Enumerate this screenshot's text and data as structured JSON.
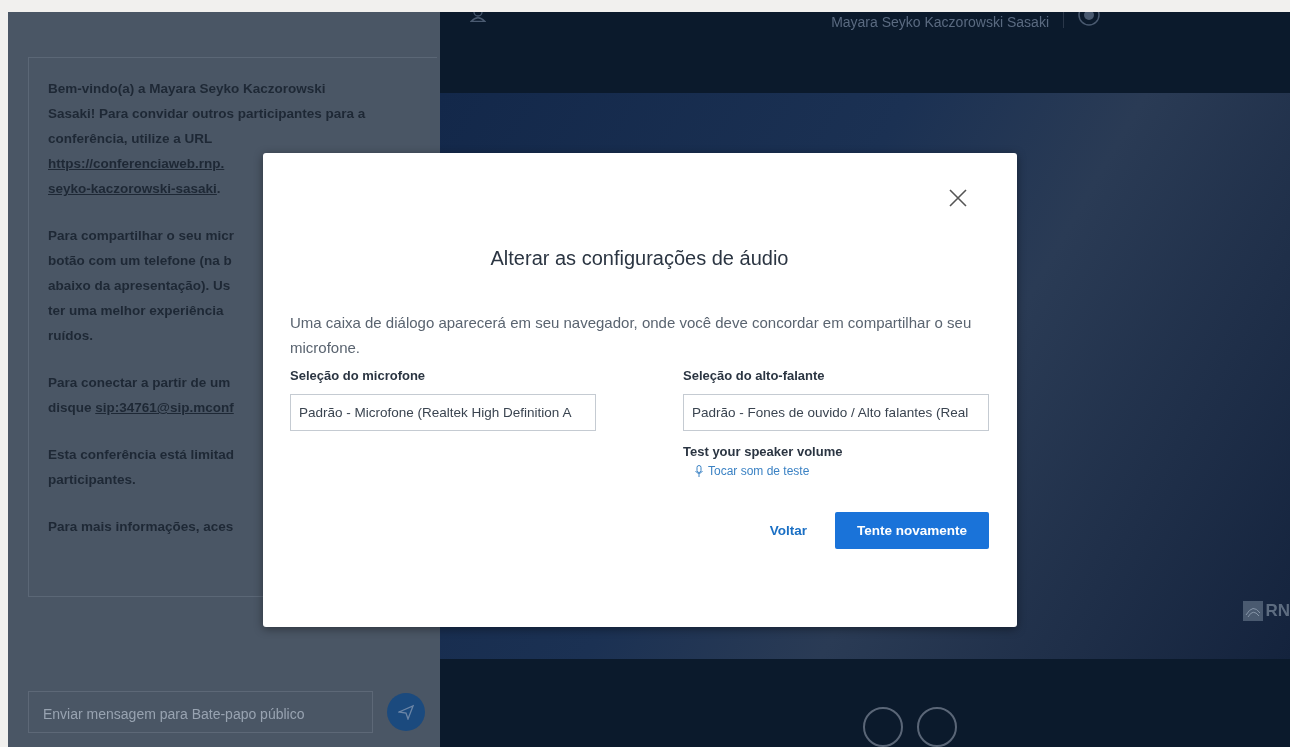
{
  "chat": {
    "paragraphs": [
      {
        "lines": [
          {
            "text": "Bem-vindo(a) a Mayara Seyko Kaczorowski"
          },
          {
            "text": "Sasaki! Para convidar outros participantes para a"
          },
          {
            "text": "conferência, utilize a URL"
          },
          {
            "text": "https://conferenciaweb.rnp.",
            "link": true
          },
          {
            "text": "seyko-kaczorowski-sasaki",
            "link": true,
            "after": "."
          }
        ]
      },
      {
        "lines": [
          {
            "text": "Para compartilhar o seu micr"
          },
          {
            "text": "botão com um telefone (na b"
          },
          {
            "text": "abaixo da apresentação). Us"
          },
          {
            "text": "ter uma melhor experiência"
          },
          {
            "text": "ruídos."
          }
        ]
      },
      {
        "lines": [
          {
            "text": "Para conectar a partir de um"
          },
          {
            "text": "disque ",
            "linkText": "sip:34761@sip.mconf"
          }
        ]
      },
      {
        "lines": [
          {
            "text": "Esta conferência está limitad"
          },
          {
            "text": "participantes."
          }
        ]
      },
      {
        "lines": [
          {
            "text": "Para mais informações, aces"
          }
        ]
      }
    ],
    "input": {
      "placeholder": "Enviar mensagem para Bate-papo público"
    }
  },
  "header": {
    "user_name": "Mayara Seyko Kaczorowski Sasaki"
  },
  "presentation": {
    "logo": "RN"
  },
  "dialog": {
    "title": "Alterar as configurações de áudio",
    "description": "Uma caixa de diálogo aparecerá em seu navegador, onde você deve concordar em compartilhar o seu microfone.",
    "microphone": {
      "label": "Seleção do microfone",
      "value": "Padrão - Microfone (Realtek High Definition A"
    },
    "speaker": {
      "label": "Seleção do alto-falante",
      "value": "Padrão - Fones de ouvido / Alto falantes (Real"
    },
    "test": {
      "label": "Test your speaker volume",
      "link": "Tocar som de teste"
    },
    "buttons": [
      {
        "label": "Voltar",
        "kind": "text"
      },
      {
        "label": "Tente novamente",
        "kind": "primary"
      }
    ]
  }
}
